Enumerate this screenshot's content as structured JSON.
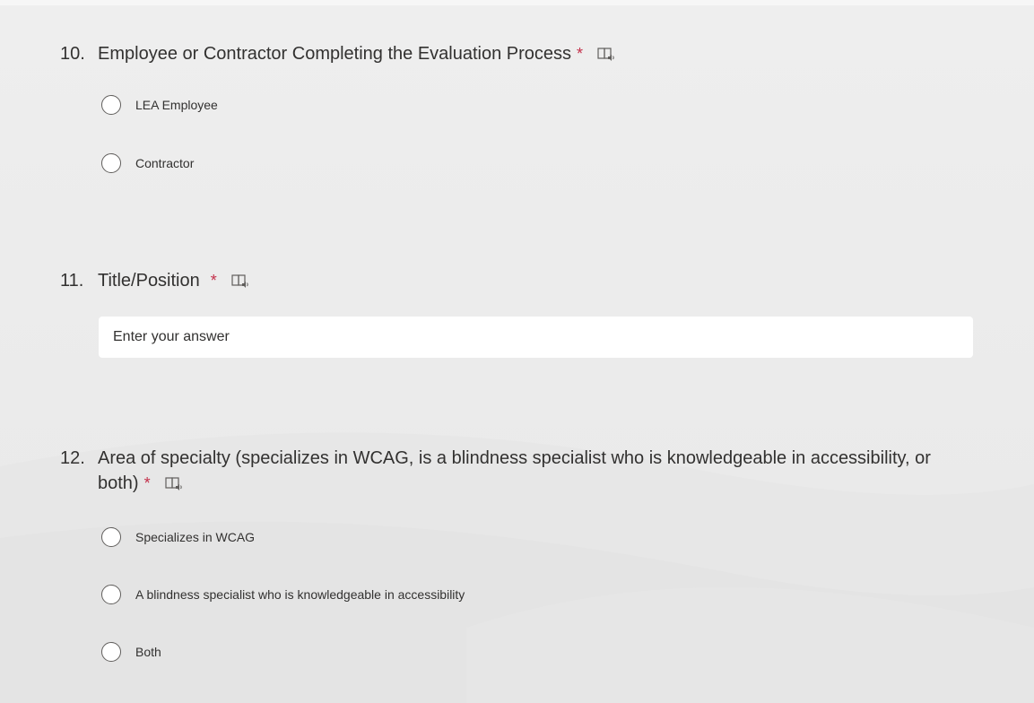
{
  "questions": [
    {
      "number": "10.",
      "title": "Employee or Contractor Completing the Evaluation Process",
      "required_mark": "*",
      "reader_icon": "immersive-reader-icon",
      "options": [
        "LEA Employee",
        "Contractor"
      ]
    },
    {
      "number": "11.",
      "title": "Title/Position",
      "required_mark": "*",
      "reader_icon": "immersive-reader-icon",
      "placeholder": "Enter your answer"
    },
    {
      "number": "12.",
      "title": "Area of specialty (specializes in WCAG, is a blindness specialist who is knowledgeable in accessibility, or both)",
      "required_mark": "*",
      "reader_icon": "immersive-reader-icon",
      "options": [
        "Specializes in WCAG",
        "A blindness specialist who is knowledgeable in accessibility",
        "Both"
      ]
    }
  ],
  "colors": {
    "background": "#ececec",
    "required": "#c4314b",
    "text": "#323130",
    "input_background": "#ffffff"
  }
}
